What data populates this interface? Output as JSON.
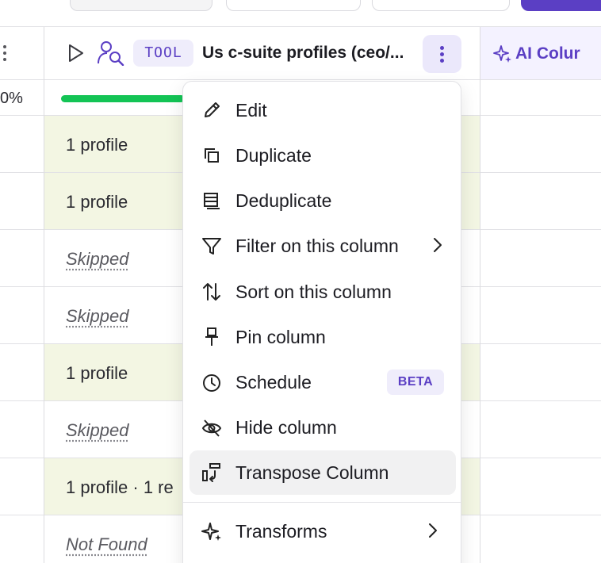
{
  "column": {
    "badge": "TOOL",
    "title": "Us c-suite profiles (ceo/...",
    "next_column": "AI Colur",
    "left_percent": "0%",
    "progress": 0.3
  },
  "rows": [
    {
      "text": "1 profile",
      "state": "found"
    },
    {
      "text": "1 profile",
      "state": "found"
    },
    {
      "text": "Skipped",
      "state": "skipped"
    },
    {
      "text": "Skipped",
      "state": "skipped"
    },
    {
      "text": "1 profile",
      "state": "found"
    },
    {
      "text": "Skipped",
      "state": "skipped"
    },
    {
      "text": "1 profile · 1 re",
      "state": "found"
    },
    {
      "text": "Not Found",
      "state": "notfound"
    }
  ],
  "menu": {
    "items": [
      {
        "label": "Edit",
        "icon": "pencil-icon"
      },
      {
        "label": "Duplicate",
        "icon": "duplicate-icon"
      },
      {
        "label": "Deduplicate",
        "icon": "deduplicate-icon"
      },
      {
        "label": "Filter on this column",
        "icon": "filter-icon",
        "submenu": true
      },
      {
        "label": "Sort on this column",
        "icon": "sort-icon"
      },
      {
        "label": "Pin column",
        "icon": "pin-icon"
      },
      {
        "label": "Schedule",
        "icon": "clock-icon",
        "badge": "BETA"
      },
      {
        "label": "Hide column",
        "icon": "eye-off-icon"
      },
      {
        "label": "Transpose Column",
        "icon": "transpose-icon",
        "hovered": true
      },
      {
        "label": "Transforms",
        "icon": "sparkle-icon",
        "submenu": true
      }
    ]
  },
  "colors": {
    "accent": "#5b3fc4",
    "progress": "#13c455",
    "found_row": "#f3f6e3",
    "badge_bg": "#efedfb"
  }
}
